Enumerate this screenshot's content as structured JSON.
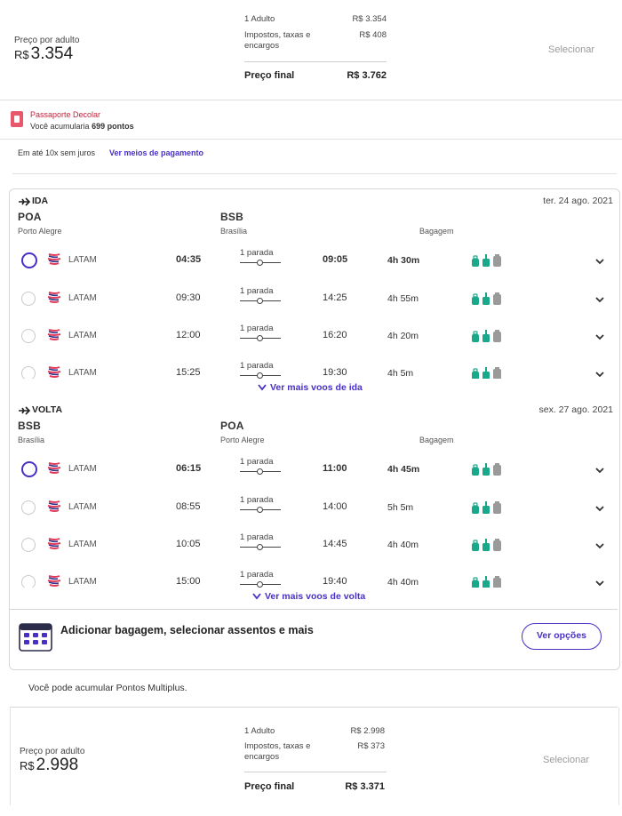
{
  "fare1": {
    "price_label": "Preço por adulto",
    "currency": "R$",
    "price": "3.354",
    "breakdown": [
      {
        "label": "1 Adulto",
        "value": "R$ 3.354"
      },
      {
        "label": "Impostos, taxas e encargos",
        "value": "R$ 408"
      }
    ],
    "final_label": "Preço final",
    "final_value": "R$ 3.762",
    "select_label": "Selecionar"
  },
  "passport": {
    "title": "Passaporte Decolar",
    "prefix": "Você acumularia",
    "points": "699 pontos"
  },
  "payment": {
    "text": "Em até 10x sem juros",
    "link": "Ver meios de pagamento"
  },
  "outbound": {
    "direction": "IDA",
    "date": "ter. 24 ago. 2021",
    "origin_code": "POA",
    "origin_city": "Porto Alegre",
    "dest_code": "BSB",
    "dest_city": "Brasília",
    "baggage_header": "Bagagem",
    "more_label": "Ver mais voos de ida",
    "flights": [
      {
        "airline": "LATAM",
        "dep": "04:35",
        "stops": "1 parada",
        "arr": "09:05",
        "duration": "4h 30m",
        "selected": true
      },
      {
        "airline": "LATAM",
        "dep": "09:30",
        "stops": "1 parada",
        "arr": "14:25",
        "duration": "4h 55m",
        "selected": false
      },
      {
        "airline": "LATAM",
        "dep": "12:00",
        "stops": "1 parada",
        "arr": "16:20",
        "duration": "4h 20m",
        "selected": false
      },
      {
        "airline": "LATAM",
        "dep": "15:25",
        "stops": "1 parada",
        "arr": "19:30",
        "duration": "4h 5m",
        "selected": false
      }
    ]
  },
  "inbound": {
    "direction": "VOLTA",
    "date": "sex. 27 ago. 2021",
    "origin_code": "BSB",
    "origin_city": "Brasília",
    "dest_code": "POA",
    "dest_city": "Porto Alegre",
    "baggage_header": "Bagagem",
    "more_label": "Ver mais voos de volta",
    "flights": [
      {
        "airline": "LATAM",
        "dep": "06:15",
        "stops": "1 parada",
        "arr": "11:00",
        "duration": "4h 45m",
        "selected": true
      },
      {
        "airline": "LATAM",
        "dep": "08:55",
        "stops": "1 parada",
        "arr": "14:00",
        "duration": "5h 5m",
        "selected": false
      },
      {
        "airline": "LATAM",
        "dep": "10:05",
        "stops": "1 parada",
        "arr": "14:45",
        "duration": "4h 40m",
        "selected": false
      },
      {
        "airline": "LATAM",
        "dep": "15:00",
        "stops": "1 parada",
        "arr": "19:40",
        "duration": "4h 40m",
        "selected": false
      }
    ]
  },
  "addons": {
    "text": "Adicionar bagagem, selecionar assentos e mais",
    "button": "Ver opções"
  },
  "multiplus": "Você pode acumular Pontos Multiplus.",
  "fare2": {
    "price_label": "Preço por adulto",
    "currency": "R$",
    "price": "2.998",
    "breakdown": [
      {
        "label": "1 Adulto",
        "value": "R$ 2.998"
      },
      {
        "label": "Impostos, taxas e encargos",
        "value": "R$ 373"
      }
    ],
    "final_label": "Preço final",
    "final_value": "R$ 3.371",
    "select_label": "Selecionar"
  },
  "colors": {
    "accent": "#4a2fc7",
    "passport_red": "#c4213b",
    "baggage_green": "#1aa88a",
    "baggage_grey": "#9a9a9a"
  }
}
